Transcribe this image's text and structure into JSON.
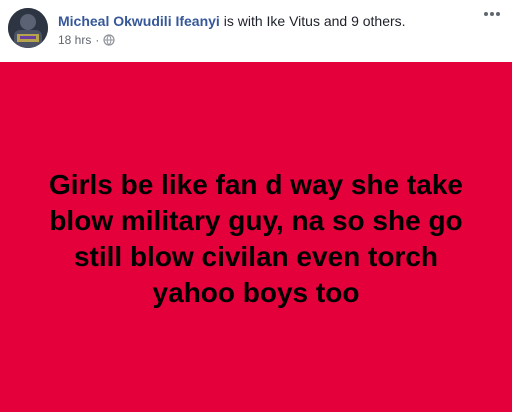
{
  "post": {
    "author": "Micheal Okwudili Ifeanyi",
    "with_text": " is with Ike Vitus and 9 others.",
    "timestamp": "18 hrs",
    "separator": "·",
    "privacy_icon": "globe-icon",
    "more_icon": "ellipsis-icon",
    "status_text": "Girls be like fan d way she take blow military guy, na so she go still blow civilan even torch yahoo boys too",
    "background_color": "#e4003a"
  }
}
